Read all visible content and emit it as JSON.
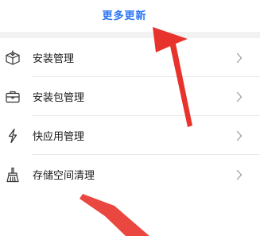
{
  "header": {
    "more_updates": "更多更新"
  },
  "menu": {
    "items": [
      {
        "label": "安装管理",
        "icon": "box-download-icon"
      },
      {
        "label": "安装包管理",
        "icon": "briefcase-icon"
      },
      {
        "label": "快应用管理",
        "icon": "lightning-icon"
      },
      {
        "label": "存储空间清理",
        "icon": "broom-icon"
      }
    ]
  },
  "colors": {
    "accent": "#2a74f6",
    "annotation_arrow": "#e8332c",
    "section_gap": "#f2f2f2"
  }
}
